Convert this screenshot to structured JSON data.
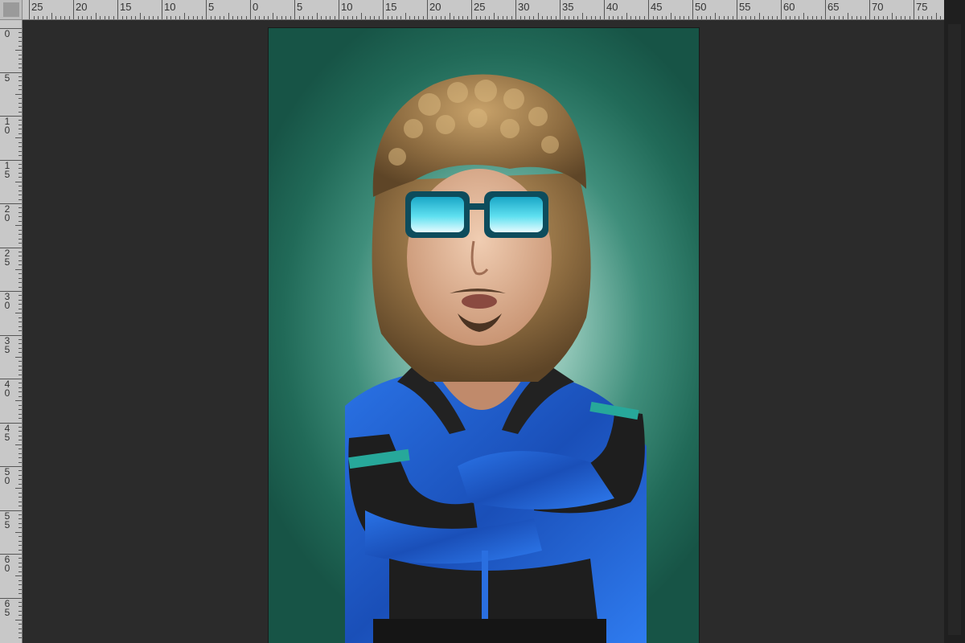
{
  "ruler": {
    "top_labels": [
      "25",
      "20",
      "15",
      "10",
      "5",
      "0",
      "5",
      "10",
      "15",
      "20",
      "25",
      "30",
      "35",
      "40",
      "45",
      "50",
      "55",
      "60",
      "65",
      "70",
      "75"
    ],
    "left_labels": [
      "0",
      "5",
      "10",
      "15",
      "20",
      "25",
      "30",
      "35",
      "40",
      "45",
      "50",
      "55",
      "60",
      "65"
    ]
  },
  "canvas": {
    "image_description_icon": "photo-canvas"
  },
  "colors": {
    "pasteboard": "#2b2b2b",
    "ruler": "#c8c8c8",
    "backdrop": "#216a58",
    "jacket_blue": "#1f5fd0",
    "jacket_black": "#1c1c1c",
    "wig": "#8a6a3c",
    "lens": "#35c7df"
  }
}
